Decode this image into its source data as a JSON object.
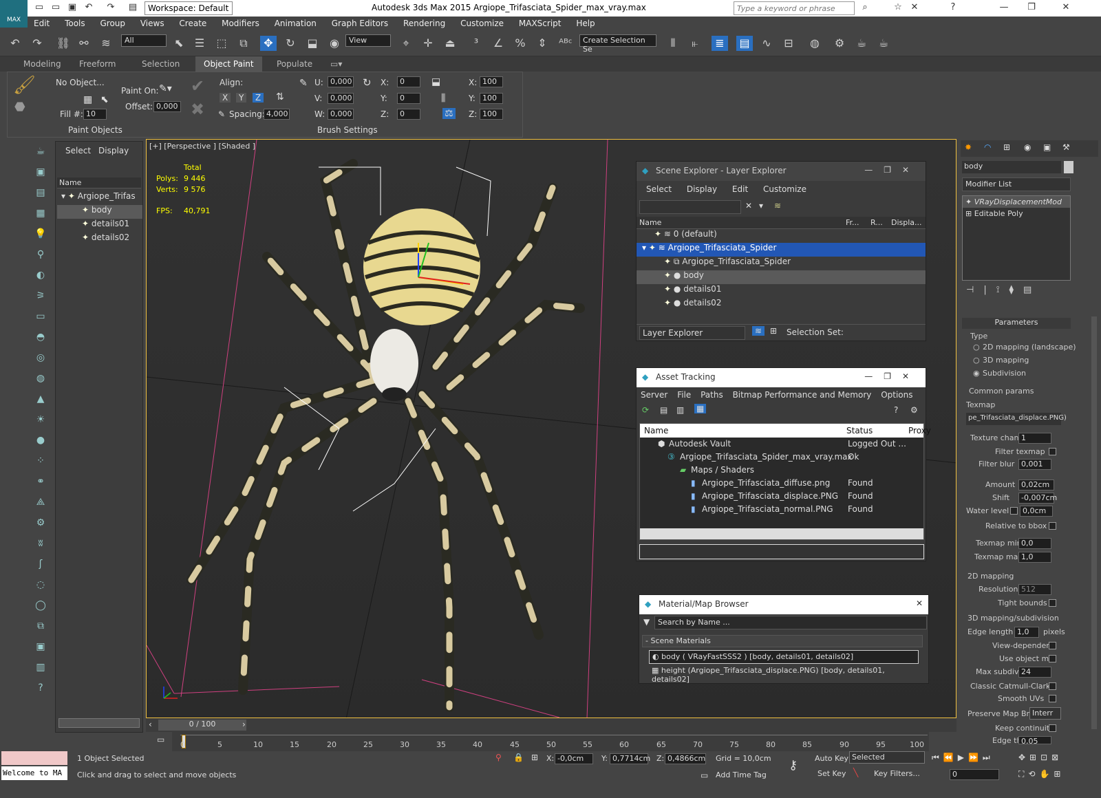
{
  "titlebar": {
    "workspace": "Workspace: Default",
    "title": "Autodesk 3ds Max  2015    Argiope_Trifasciata_Spider_max_vray.max",
    "search_placeholder": "Type a keyword or phrase"
  },
  "menu": [
    "Edit",
    "Tools",
    "Group",
    "Views",
    "Create",
    "Modifiers",
    "Animation",
    "Graph Editors",
    "Rendering",
    "Customize",
    "MAXScript",
    "Help"
  ],
  "toolbar": {
    "filter": "All",
    "view": "View",
    "selection_set": "Create Selection Se"
  },
  "ribbon_tabs": [
    "Modeling",
    "Freeform",
    "Selection",
    "Object Paint",
    "Populate"
  ],
  "ribbon": {
    "no_object": "No Object...",
    "paint_on": "Paint On:",
    "offset_lbl": "Offset:",
    "offset": "0,000",
    "fill_lbl": "Fill #:",
    "fill": "10",
    "align": "Align:",
    "x": "X",
    "y": "Y",
    "z": "Z",
    "spacing_lbl": "Spacing:",
    "spacing": "4,000",
    "u": "U:",
    "v": "V:",
    "w": "W:",
    "uval": "0,000",
    "vval": "0,000",
    "wval": "0,000",
    "xl": "X:",
    "yl": "Y:",
    "zl": "Z:",
    "rot": "0",
    "sx": "100",
    "sy": "100",
    "sz": "100",
    "paint_objects": "Paint Objects",
    "brush_settings": "Brush Settings"
  },
  "scene": {
    "tabs": [
      "Select",
      "Display"
    ],
    "header": "Name",
    "items": [
      "Argiope_Trifas",
      "body",
      "details01",
      "details02"
    ]
  },
  "viewport": {
    "label": "[+] [Perspective ] [Shaded ]",
    "total": "Total",
    "polys_lbl": "Polys:",
    "polys": "9 446",
    "verts_lbl": "Verts:",
    "verts": "9 576",
    "fps_lbl": "FPS:",
    "fps": "40,791"
  },
  "layer": {
    "title": "Scene Explorer - Layer Explorer",
    "menu": [
      "Select",
      "Display",
      "Edit",
      "Customize"
    ],
    "cols": [
      "Name",
      "Fr...",
      "R...",
      "Displa..."
    ],
    "rows": [
      "0 (default)",
      "Argiope_Trifasciata_Spider",
      "Argiope_Trifasciata_Spider",
      "body",
      "details01",
      "details02"
    ],
    "footer": "Layer Explorer",
    "selset": "Selection Set:"
  },
  "asset": {
    "title": "Asset Tracking",
    "menu": [
      "Server",
      "File",
      "Paths",
      "Bitmap Performance and Memory",
      "Options"
    ],
    "cols": [
      "Name",
      "Status",
      "Proxy"
    ],
    "rows": [
      {
        "name": "Autodesk Vault",
        "status": "Logged Out ..."
      },
      {
        "name": "Argiope_Trifasciata_Spider_max_vray.max",
        "status": "Ok"
      },
      {
        "name": "Maps / Shaders",
        "status": ""
      },
      {
        "name": "Argiope_Trifasciata_diffuse.png",
        "status": "Found"
      },
      {
        "name": "Argiope_Trifasciata_displace.PNG",
        "status": "Found"
      },
      {
        "name": "Argiope_Trifasciata_normal.PNG",
        "status": "Found"
      }
    ]
  },
  "matbrowser": {
    "title": "Material/Map Browser",
    "search": "Search by Name ...",
    "group": "- Scene Materials",
    "items": [
      "body  ( VRayFastSSS2 ) [body, details01, details02]",
      "height (Argiope_Trifasciata_displace.PNG) [body, details01, details02]"
    ]
  },
  "cmd": {
    "name": "body",
    "modlist": "Modifier List",
    "stack": [
      "VRayDisplacementMod",
      "Editable Poly"
    ],
    "params": "Parameters",
    "type": "Type",
    "opts": [
      "2D mapping (landscape)",
      "3D mapping",
      "Subdivision"
    ],
    "common": "Common params",
    "texmap": "Texmap",
    "texmap_val": "pe_Trifasciata_displace.PNG)",
    "texchan_lbl": "Texture chan",
    "texchan": "1",
    "filter_texmap": "Filter texmap",
    "filter_blur_lbl": "Filter blur",
    "filter_blur": "0,001",
    "amount_lbl": "Amount",
    "amount": "0,02cm",
    "shift_lbl": "Shift",
    "shift": "-0,007cm",
    "water_lbl": "Water level",
    "water": "0,0cm",
    "rel_bbox": "Relative to bbox",
    "tmin_lbl": "Texmap min",
    "tmin": "0,0",
    "tmax_lbl": "Texmap max",
    "tmax": "1,0",
    "map2d": "2D mapping",
    "res_lbl": "Resolution",
    "res": "512",
    "tight": "Tight bounds",
    "map3d": "3D mapping/subdivision",
    "edge_lbl": "Edge length",
    "edge": "1,0",
    "pixels": "pixels",
    "viewdep": "View-dependent",
    "useobj": "Use object mtl",
    "maxsub_lbl": "Max subdivs",
    "maxsub": "24",
    "catmull": "Classic Catmull-Clark",
    "smooth": "Smooth UVs",
    "preserve_lbl": "Preserve Map Bnd",
    "preserve": "Interr",
    "keepcont": "Keep continuity",
    "edgethresh": "Edge thresh",
    "edgethresh_val": "0,05"
  },
  "timeline": {
    "frame": "0 / 100",
    "ticks": [
      "0",
      "5",
      "10",
      "15",
      "20",
      "25",
      "30",
      "35",
      "40",
      "45",
      "50",
      "55",
      "60",
      "65",
      "70",
      "75",
      "80",
      "85",
      "90",
      "95",
      "100"
    ]
  },
  "status": {
    "welcome": "Welcome to MA",
    "selected": "1 Object Selected",
    "hint": "Click and drag to select and move objects",
    "x_lbl": "X:",
    "x": "-0,0cm",
    "y_lbl": "Y:",
    "y": "0,7714cm",
    "z_lbl": "Z:",
    "z": "0,4866cm",
    "grid": "Grid = 10,0cm",
    "autokey": "Auto Key",
    "setkey": "Set Key",
    "selected_dd": "Selected",
    "keyfilters": "Key Filters...",
    "addtimetag": "Add Time Tag",
    "frame": "0"
  }
}
